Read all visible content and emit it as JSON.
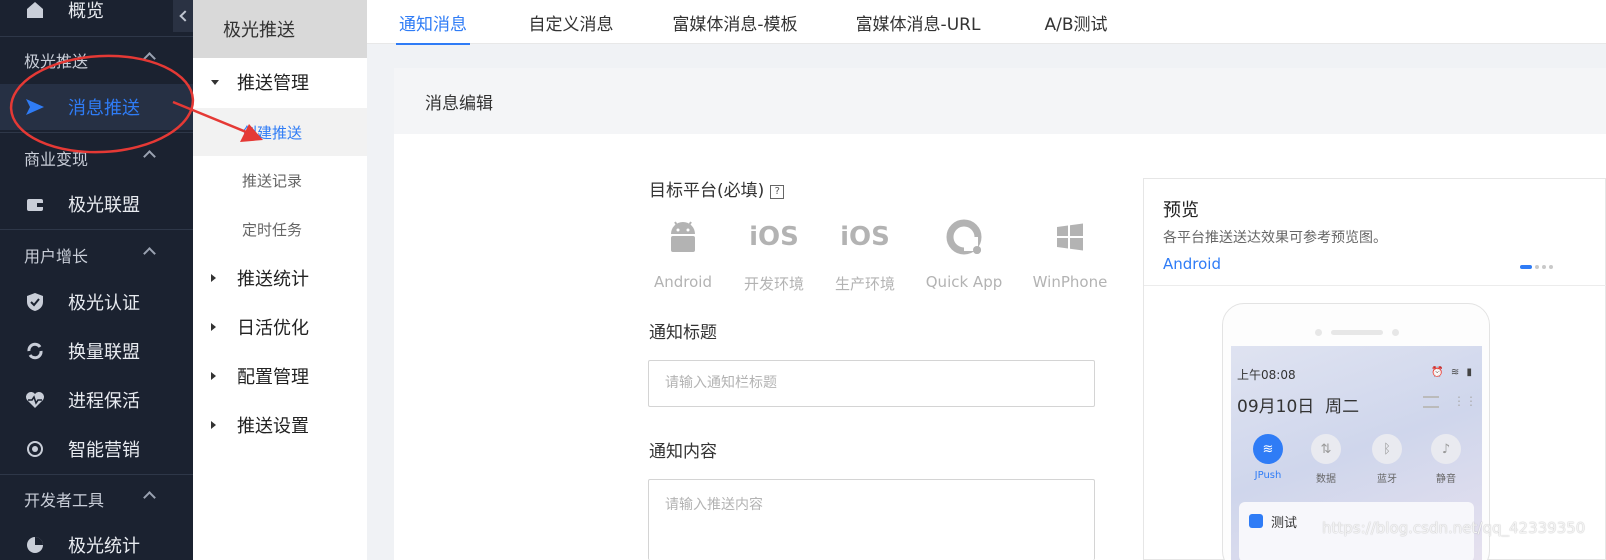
{
  "sidebar": {
    "overview_label": "概览",
    "groups": [
      {
        "label": "极光推送"
      },
      {
        "label": "商业变现"
      },
      {
        "label": "用户增长"
      },
      {
        "label": "开发者工具"
      }
    ],
    "items": {
      "push": "消息推送",
      "alliance": "极光联盟",
      "auth": "极光认证",
      "exchange": "换量联盟",
      "keepalive": "进程保活",
      "marketing": "智能营销",
      "stats": "极光统计"
    }
  },
  "submenu": {
    "title": "极光推送",
    "push_mgmt": "推送管理",
    "create_push": "创建推送",
    "push_record": "推送记录",
    "scheduled": "定时任务",
    "push_stats": "推送统计",
    "dau_opt": "日活优化",
    "config": "配置管理",
    "settings": "推送设置"
  },
  "tabs": [
    "通知消息",
    "自定义消息",
    "富媒体消息-模板",
    "富媒体消息-URL",
    "A/B测试"
  ],
  "editor": {
    "header": "消息编辑",
    "platform_label": "目标平台(必填)",
    "help": "?",
    "platforms": [
      {
        "icon": "android-icon",
        "label": "Android"
      },
      {
        "icon": "ios-dev-icon",
        "glyph": "iOS",
        "label": "开发环境"
      },
      {
        "icon": "ios-prod-icon",
        "glyph": "iOS",
        "label": "生产环境"
      },
      {
        "icon": "quickapp-icon",
        "label": "Quick App"
      },
      {
        "icon": "windows-icon",
        "label": "WinPhone"
      }
    ],
    "title_label": "通知标题",
    "title_placeholder": "请输入通知栏标题",
    "content_label": "通知内容",
    "content_placeholder": "请输入推送内容"
  },
  "preview": {
    "title": "预览",
    "desc": "各平台推送送达效果可参考预览图。",
    "os": "Android",
    "phone": {
      "time": "上午08:08",
      "date": "09月10日",
      "weekday": "周二",
      "quick": [
        {
          "label": "JPush",
          "active": true
        },
        {
          "label": "数据",
          "active": false
        },
        {
          "label": "蓝牙",
          "active": false
        },
        {
          "label": "静音",
          "active": false
        }
      ],
      "notif_title": "测试"
    }
  },
  "watermark": "https://blog.csdn.net/qq_42339350",
  "colors": {
    "accent": "#2f7cf6",
    "sidebar_bg": "#1b2230",
    "annotation": "#e53935"
  }
}
